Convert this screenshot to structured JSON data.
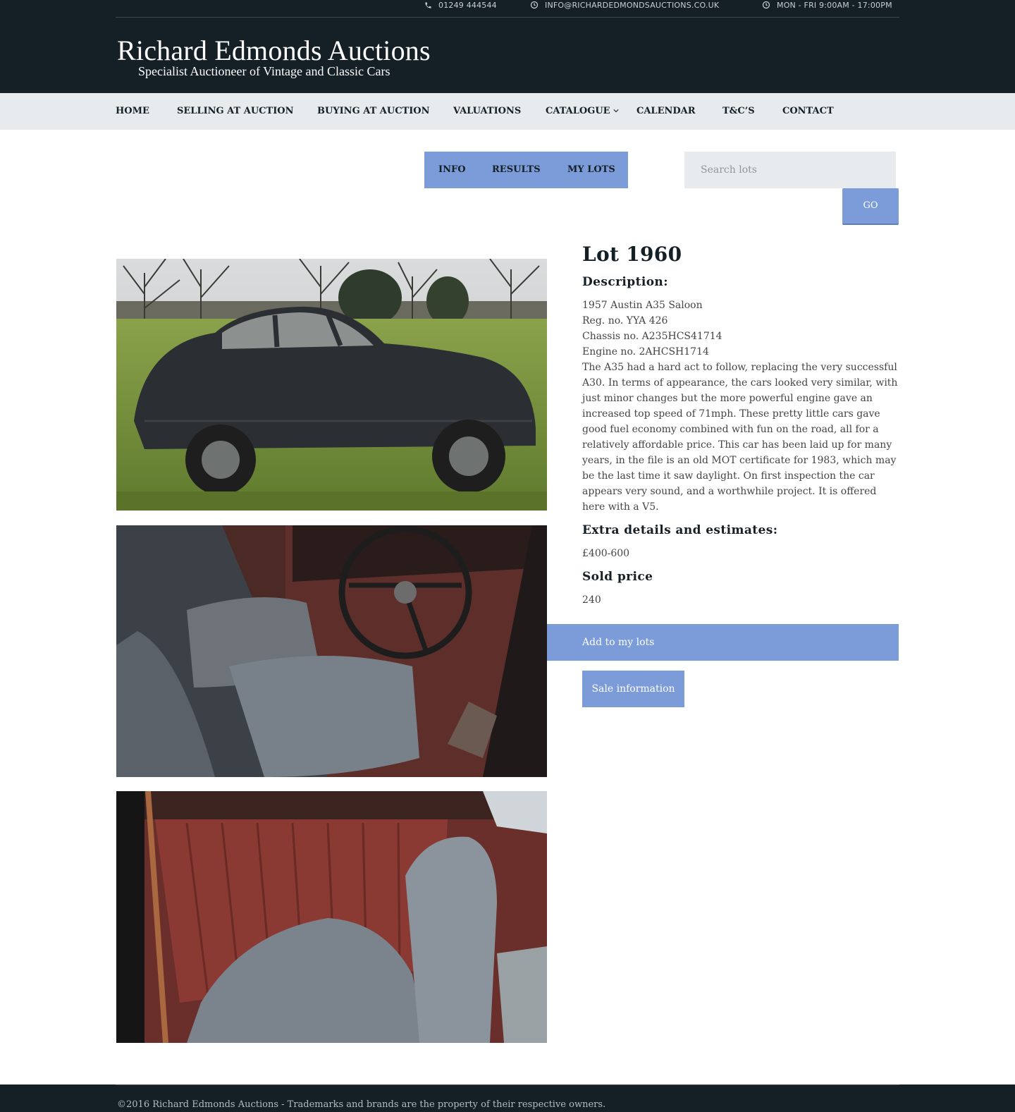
{
  "topbar": {
    "phone": "01249 444544",
    "email": "INFO@RICHARDEDMONDSAUCTIONS.CO.UK",
    "hours": "MON - FRI 9:00AM - 17:00PM"
  },
  "logo": {
    "title": "Richard Edmonds Auctions",
    "subtitle": "Specialist Auctioneer of Vintage and Classic Cars"
  },
  "nav": {
    "items": [
      {
        "label": "HOME"
      },
      {
        "label": "SELLING AT AUCTION"
      },
      {
        "label": "BUYING AT AUCTION"
      },
      {
        "label": "VALUATIONS"
      },
      {
        "label": "CATALOGUE",
        "has_dropdown": true
      },
      {
        "label": "CALENDAR"
      },
      {
        "label": "T&C’S"
      },
      {
        "label": "CONTACT"
      }
    ]
  },
  "subnav": {
    "items": [
      {
        "label": "INFO"
      },
      {
        "label": "RESULTS"
      },
      {
        "label": "MY LOTS"
      }
    ]
  },
  "search": {
    "placeholder": "Search lots",
    "value": "",
    "button_label": "GO"
  },
  "lot": {
    "title": "Lot 1960",
    "description_heading": "Description:",
    "description_lines": [
      "1957 Austin A35 Saloon",
      "Reg. no. YYA 426",
      "Chassis no. A235HCS41714",
      "Engine no. 2AHCSH1714",
      "The A35 had a hard act to follow, replacing the very successful A30. In terms of appearance, the cars looked very similar, with just minor changes but the more powerful engine gave an increased top speed of 71mph. These pretty little cars gave good fuel economy combined with fun on the road, all for a relatively affordable price. This car has been laid up for many years, in the file is an old MOT certificate for 1983, which may be the last time it saw daylight. On first inspection the car appears very sound, and a worthwhile project. It is offered here with a V5."
    ],
    "extra_heading": "Extra details and estimates:",
    "estimate": "£400-600",
    "sold_heading": "Sold price",
    "sold_price": "240",
    "add_button": "Add to my lots",
    "sale_info_button": "Sale information"
  },
  "photos": [
    {
      "subject": "car-exterior"
    },
    {
      "subject": "car-interior-front"
    },
    {
      "subject": "car-interior-rear"
    }
  ],
  "footer": {
    "text": "©2016 Richard Edmonds Auctions - Trademarks and brands are the property of their respective owners."
  },
  "colors": {
    "header_bg": "#151f26",
    "nav_bg": "#e7ebee",
    "accent": "#7b9cd8",
    "text_dark": "#151f26"
  }
}
